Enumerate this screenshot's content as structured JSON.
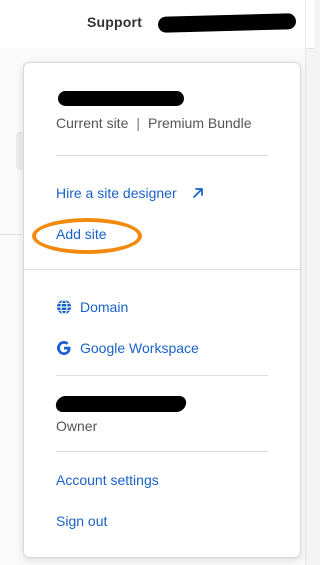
{
  "header": {
    "support_label": "Support"
  },
  "dropdown": {
    "site": {
      "current_site_label": "Current site",
      "separator": "|",
      "plan": "Premium Bundle"
    },
    "actions": {
      "hire_label": "Hire a site designer",
      "add_site_label": "Add site"
    },
    "services": {
      "domain_label": "Domain",
      "google_label": "Google Workspace"
    },
    "account": {
      "role": "Owner",
      "settings_label": "Account settings",
      "signout_label": "Sign out"
    }
  },
  "icons": {
    "hire": "arrow-up-right-icon",
    "domain": "globe-icon",
    "google": "google-g-icon"
  },
  "colors": {
    "link": "#1a61c9",
    "highlight_ring": "#f28a0f"
  }
}
